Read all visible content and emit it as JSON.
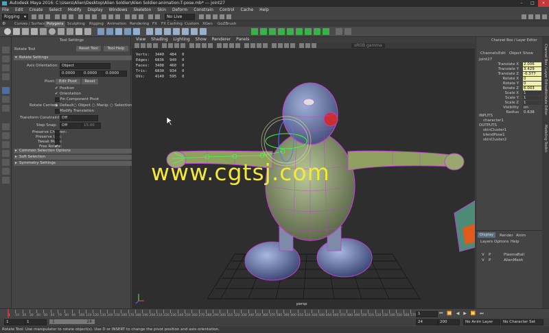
{
  "window": {
    "title": "Autodesk Maya 2016: C:\\Users\\Alien\\Desktop\\Alien Soldier\\Alien Soldier-animation-T-pose.mb* --- joint27"
  },
  "menubar": [
    "File",
    "Edit",
    "Create",
    "Select",
    "Modify",
    "Display",
    "Windows",
    "Skeleton",
    "Skin",
    "Deform",
    "Constrain",
    "Control",
    "Cache",
    "Help"
  ],
  "toolbar": {
    "menuset": "Rigging",
    "live_surface": "No Live Surface"
  },
  "shelf_tabs": [
    "Curves / Surfaces",
    "Polygons",
    "Sculpting",
    "Rigging",
    "Animation",
    "Rendering",
    "FX",
    "FX Caching",
    "Custom",
    "XGen",
    "GoZBrush"
  ],
  "shelf_active": "Polygons",
  "tool_settings": {
    "header": "Tool Settings",
    "tool_name": "Rotate Tool",
    "reset_tool": "Reset Tool",
    "tool_help": "Tool Help",
    "rotate_settings": "Rotate Settings",
    "axis_orientation_label": "Axis Orientation:",
    "axis_orientation_value": "Object",
    "axis_values": [
      "0.0000",
      "0.0000",
      "0.0000"
    ],
    "pivot_label": "Pivot:",
    "edit_pivot": "Edit Pivot",
    "reset": "Reset",
    "position": "Position",
    "orientation": "Orientation",
    "pin_component_pivot": "Pin Component Pivot",
    "rotate_center_label": "Rotate Center:",
    "rc_default": "Default",
    "rc_object": "Object",
    "rc_manip": "Manip",
    "rc_selection": "Selection",
    "modify_translation": "Modify Translation",
    "transform_constraint_label": "Transform Constraint:",
    "transform_constraint_value": "Off",
    "step_snap_label": "Step Snap:",
    "step_snap_value": "Off",
    "step_snap_amount": "15.00",
    "preserve_children": "Preserve Children:",
    "preserve_uvs": "Preserve UVs:",
    "tweak_mode": "Tweak Mode:",
    "free_rotate": "Free Rotate:",
    "sections": [
      "Common Selection Options",
      "Soft Selection",
      "Symmetry Settings"
    ]
  },
  "viewport": {
    "menus": [
      "View",
      "Shading",
      "Lighting",
      "Show",
      "Renderer",
      "Panels"
    ],
    "gamma": "sRGB gamma",
    "hud": [
      {
        "label": "Verts:",
        "a": "3440",
        "b": "484",
        "c": "0"
      },
      {
        "label": "Edges:",
        "a": "6836",
        "b": "940",
        "c": "0"
      },
      {
        "label": "Faces:",
        "a": "3408",
        "b": "460",
        "c": "0"
      },
      {
        "label": "Tris:",
        "a": "6830",
        "b": "934",
        "c": "0"
      },
      {
        "label": "UVs:",
        "a": "4140",
        "b": "595",
        "c": "0"
      }
    ],
    "camera": "persp",
    "watermark": "www.cgtsj.com"
  },
  "channel_box": {
    "header": "Channel Box / Layer Editor",
    "menus": [
      "Channels",
      "Edit",
      "Object",
      "Show"
    ],
    "object": "joint27",
    "channels": [
      {
        "name": "Translate X",
        "value": "2.006"
      },
      {
        "name": "Translate Y",
        "value": "3.429"
      },
      {
        "name": "Translate Z",
        "value": "-0.377"
      },
      {
        "name": "Rotate X",
        "value": "0"
      },
      {
        "name": "Rotate Y",
        "value": "0"
      },
      {
        "name": "Rotate Z",
        "value": "6.003"
      },
      {
        "name": "Scale X",
        "value": "1"
      },
      {
        "name": "Scale Y",
        "value": "1"
      },
      {
        "name": "Scale Z",
        "value": "1"
      },
      {
        "name": "Visibility",
        "value": "on"
      },
      {
        "name": "Radius",
        "value": "0.638"
      }
    ],
    "inputs_label": "INPUTS",
    "inputs": [
      "character1"
    ],
    "outputs_label": "OUTPUTS",
    "outputs": [
      "skinCluster1",
      "blendPose1",
      "skinCluster2"
    ]
  },
  "side_tabs": [
    "Channel Box / Layer Editor",
    "Attribute Editor",
    "Modeling Toolkit"
  ],
  "layer_editor": {
    "tabs": [
      "Display",
      "Render",
      "Anim"
    ],
    "menus": [
      "Layers",
      "Options",
      "Help"
    ],
    "layers": [
      {
        "v": "V",
        "p": "P",
        "name": "PlasmaBall"
      },
      {
        "v": "V",
        "p": "P",
        "name": "AlienMesh"
      }
    ]
  },
  "timeline": {
    "ticks": [
      "1",
      "10",
      "20",
      "30",
      "40",
      "50",
      "60",
      "70",
      "80",
      "90",
      "100",
      "110",
      "120",
      "130",
      "140",
      "150",
      "160",
      "170",
      "180",
      "190",
      "200",
      "210",
      "220",
      "230",
      "240",
      "250",
      "260",
      "270",
      "280",
      "290",
      "300",
      "310",
      "320",
      "330",
      "340",
      "350",
      "360",
      "370",
      "380",
      "390",
      "400",
      "410",
      "420",
      "430",
      "440",
      "450",
      "460",
      "470",
      "480",
      "490",
      "500",
      "510",
      "520",
      "530",
      "540",
      "550",
      "560",
      "570"
    ],
    "current_frame": "1"
  },
  "range": {
    "start": "1",
    "start2": "1",
    "range_start": "1",
    "range_end": "24",
    "end": "24",
    "end2": "200",
    "anim_layer": "No Anim Layer",
    "char_set": "No Character Set"
  },
  "help_line": "Rotate Tool: Use manipulator to rotate object(s). Use D or INSERT to change the pivot position and axis orientation.",
  "colors": {
    "accent_blue": "#4a6fa5",
    "selected_field": "#f1f0b0",
    "wireframe": "#b040c0",
    "joint": "#4aff4a",
    "watermark": "#f4e83a"
  }
}
